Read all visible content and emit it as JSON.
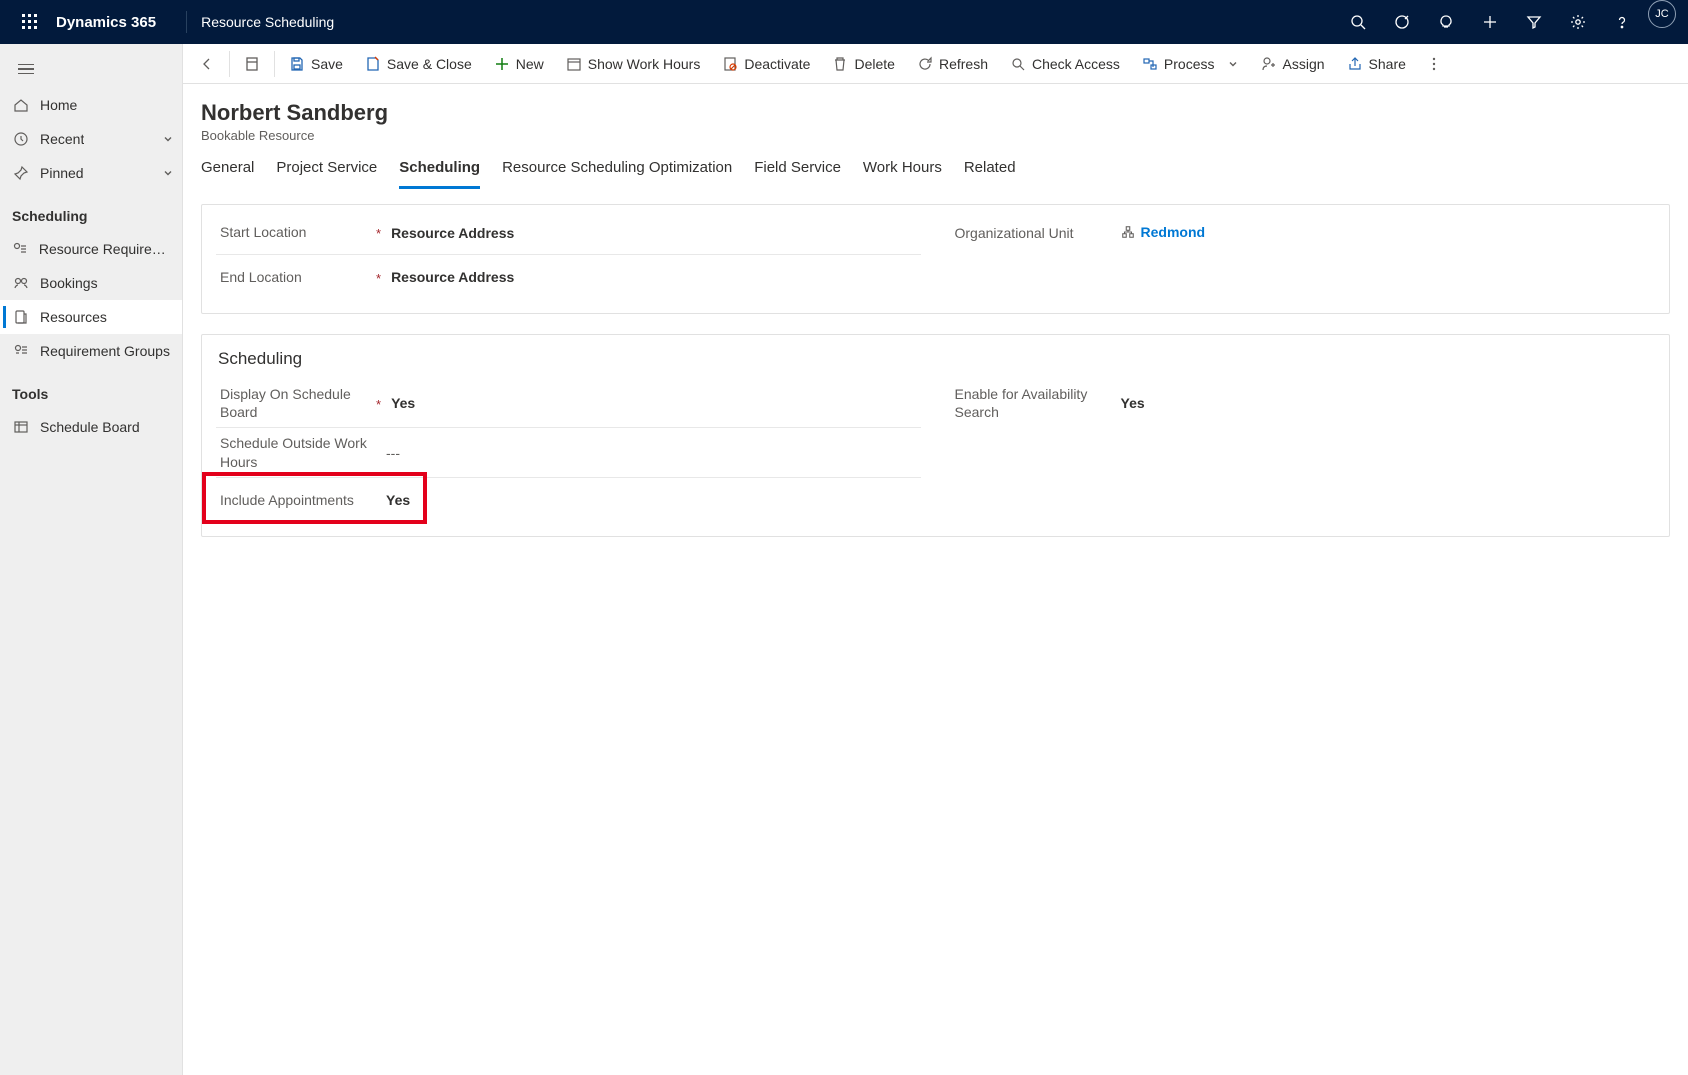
{
  "header": {
    "brand": "Dynamics 365",
    "area": "Resource Scheduling",
    "avatar_initials": "JC"
  },
  "sidebar": {
    "home": "Home",
    "recent": "Recent",
    "pinned": "Pinned",
    "group_scheduling": "Scheduling",
    "items": {
      "resource_requirements": "Resource Requireme...",
      "bookings": "Bookings",
      "resources": "Resources",
      "requirement_groups": "Requirement Groups"
    },
    "group_tools": "Tools",
    "schedule_board": "Schedule Board"
  },
  "cmd": {
    "save": "Save",
    "save_close": "Save & Close",
    "new": "New",
    "show_work_hours": "Show Work Hours",
    "deactivate": "Deactivate",
    "delete": "Delete",
    "refresh": "Refresh",
    "check_access": "Check Access",
    "process": "Process",
    "assign": "Assign",
    "share": "Share"
  },
  "record": {
    "title": "Norbert Sandberg",
    "subtitle": "Bookable Resource"
  },
  "tabs": {
    "general": "General",
    "project_service": "Project Service",
    "scheduling": "Scheduling",
    "rso": "Resource Scheduling Optimization",
    "field_service": "Field Service",
    "work_hours": "Work Hours",
    "related": "Related"
  },
  "form": {
    "start_location_label": "Start Location",
    "start_location_value": "Resource Address",
    "end_location_label": "End Location",
    "end_location_value": "Resource Address",
    "org_unit_label": "Organizational Unit",
    "org_unit_value": "Redmond",
    "section_scheduling": "Scheduling",
    "display_on_board_label": "Display On Schedule Board",
    "display_on_board_value": "Yes",
    "schedule_outside_label": "Schedule Outside Work Hours",
    "schedule_outside_value": "---",
    "include_appointments_label": "Include Appointments",
    "include_appointments_value": "Yes",
    "enable_avail_label": "Enable for Availability Search",
    "enable_avail_value": "Yes"
  }
}
